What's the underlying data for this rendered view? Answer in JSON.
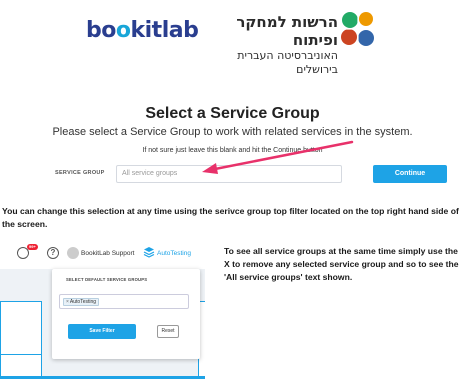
{
  "header": {
    "brand_left": "bo",
    "brand_mid": "o",
    "brand_right": "kitlab",
    "hebrew_line1": "הרשות למחקר ופיתוח",
    "hebrew_line2": "האוניברסיטה העברית בירושלים"
  },
  "selector": {
    "title": "Select a Service Group",
    "subtitle": "Please select a Service Group to work with related services in the system.",
    "hint": "If not sure just leave this blank and hit the Continue button",
    "field_label": "SERVICE GROUP",
    "field_placeholder": "All service groups",
    "continue_label": "Continue"
  },
  "paragraph1": "You can change this selection at any time using the serivce group top filter located on the top right hand side of the screen.",
  "inset": {
    "badge": "99+",
    "help_glyph": "?",
    "user_name": "BookitLab Support",
    "current_group": "AutoTesting",
    "dropdown_title": "SELECT DEFAULT SERVICE GROUPS",
    "chip_x": "×",
    "chip_label": "AutoTesting",
    "save_label": "Save Filter",
    "reset_label": "Reset"
  },
  "paragraph2": "To see all service groups at the same time simply use the X to remove any selected service group and so to see the 'All service groups' text shown.",
  "colors": {
    "accent": "#1ea3e6",
    "arrow": "#e8316a",
    "brand_dark": "#2a3e8f"
  }
}
